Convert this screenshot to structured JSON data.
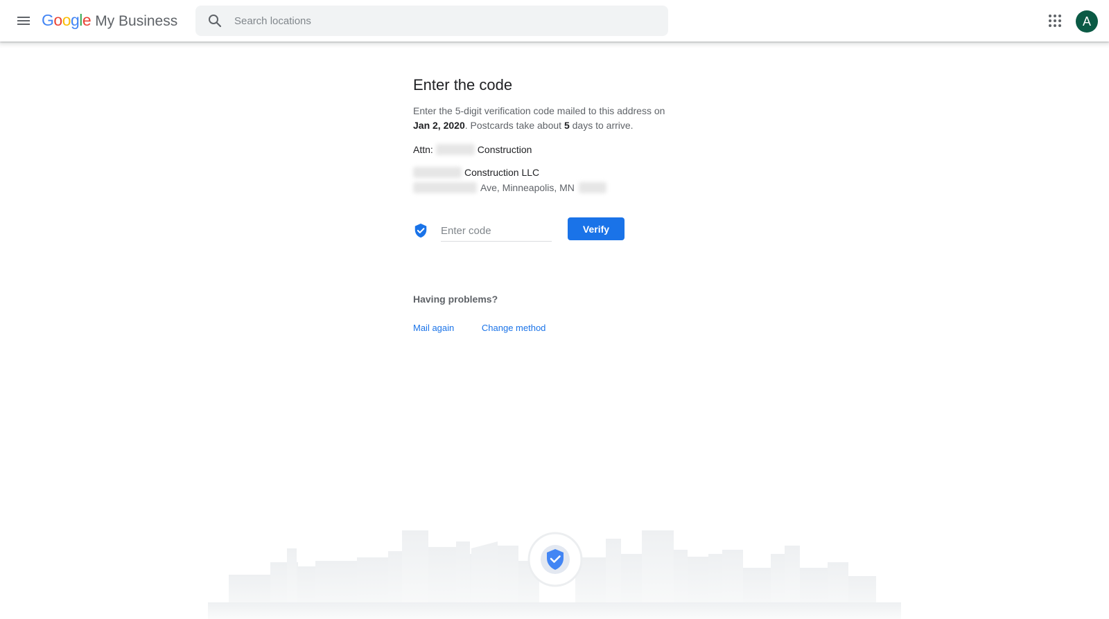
{
  "header": {
    "menu_icon": "hamburger-menu-icon",
    "logo": {
      "letters": [
        {
          "char": "G",
          "color": "#4285F4"
        },
        {
          "char": "o",
          "color": "#EA4335"
        },
        {
          "char": "o",
          "color": "#FBBC05"
        },
        {
          "char": "g",
          "color": "#4285F4"
        },
        {
          "char": "l",
          "color": "#34A853"
        },
        {
          "char": "e",
          "color": "#EA4335"
        }
      ],
      "product": "My Business"
    },
    "search": {
      "icon": "search-icon",
      "placeholder": "Search locations"
    },
    "apps_icon": "apps-grid-icon",
    "avatar_letter": "A",
    "avatar_color": "#0b5a45"
  },
  "main": {
    "title": "Enter the code",
    "description": {
      "part1": "Enter the 5-digit verification code mailed to this address on",
      "date": "Jan 2, 2020",
      "part2": ". Postcards take about",
      "days": "5",
      "part3": "days to arrive."
    },
    "attn_label": "Attn:",
    "attn_name": "Construction",
    "address": {
      "line1": "Construction LLC",
      "line2": "Ave, Minneapolis, MN"
    },
    "code_field": {
      "icon": "verified-shield-icon",
      "placeholder": "Enter code"
    },
    "verify_label": "Verify",
    "problems_heading": "Having problems?",
    "links": {
      "mail_again": "Mail again",
      "change_method": "Change method"
    }
  },
  "colors": {
    "accent": "#1a73e8",
    "text_primary": "#202124",
    "text_secondary": "#5f6368"
  },
  "footer_icon": "verified-shield-icon"
}
